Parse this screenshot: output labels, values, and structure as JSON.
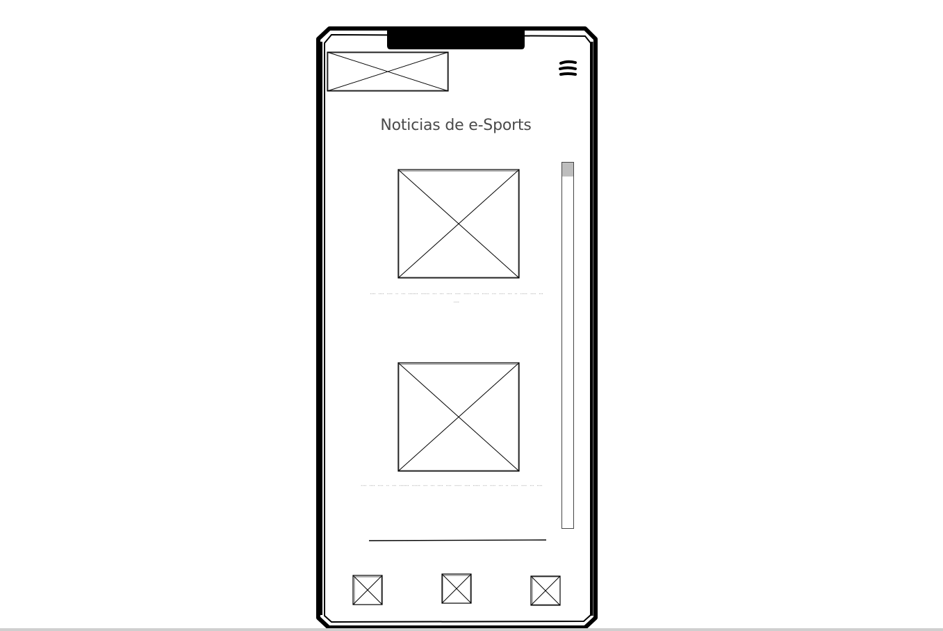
{
  "header": {
    "logo_icon": "logo-placeholder-icon",
    "menu_icon": "hamburger-menu-icon"
  },
  "main": {
    "title": "Noticias de e-Sports",
    "articles": [
      {
        "image_icon": "article-image-placeholder-icon",
        "caption": "ᐧᐧᐧᐧ ᐧᐧᐧᐧ ᐧᐧᐧᐧ ᐧᐧ ᐧᐧᐧ ᐧᐧᐧᐧᐧᐧᐧ ᐧᐧᐧᐧᐧᐧ ᐧᐧᐧ ᐧᐧᐧ ᐧᐧᐧᐧ ᐧᐧᐧᐧ ᐧᐧᐧᐧᐧ ᐧᐧᐧᐧ ᐧᐧᐧᐧᐧ ᐧᐧᐧ ᐧᐧᐧᐧ ᐧᐧᐧ ᐧᐧ ᐧᐧᐧᐧᐧ ᐧᐧᐧᐧ ᐧᐧᐧ ᐧᐧᐧᐧ"
      },
      {
        "image_icon": "article-image-placeholder-icon",
        "caption": "ᐧᐧᐧᐧ ᐧᐧᐧᐧ ᐧᐧᐧᐧ ᐧᐧ ᐧᐧᐧ ᐧᐧᐧᐧᐧᐧᐧ ᐧᐧᐧᐧᐧᐧ ᐧᐧᐧ ᐧᐧᐧ ᐧᐧᐧᐧ ᐧᐧᐧᐧ ᐧᐧᐧᐧᐧ ᐧᐧᐧᐧ ᐧᐧᐧᐧᐧ ᐧᐧᐧ ᐧᐧᐧᐧ ᐧᐧᐧ ᐧᐧ ᐧᐧᐧᐧᐧ ᐧᐧᐧᐧ ᐧᐧᐧ ᐧᐧᐧᐧ"
      }
    ],
    "scrollbar_position": 0
  },
  "bottom_nav": {
    "items": [
      {
        "icon": "nav-placeholder-icon"
      },
      {
        "icon": "nav-placeholder-icon"
      },
      {
        "icon": "nav-placeholder-icon"
      }
    ]
  },
  "colors": {
    "frame": "#000000",
    "title_text": "#4a4a4a",
    "scroll_thumb": "#bdbdbd"
  }
}
